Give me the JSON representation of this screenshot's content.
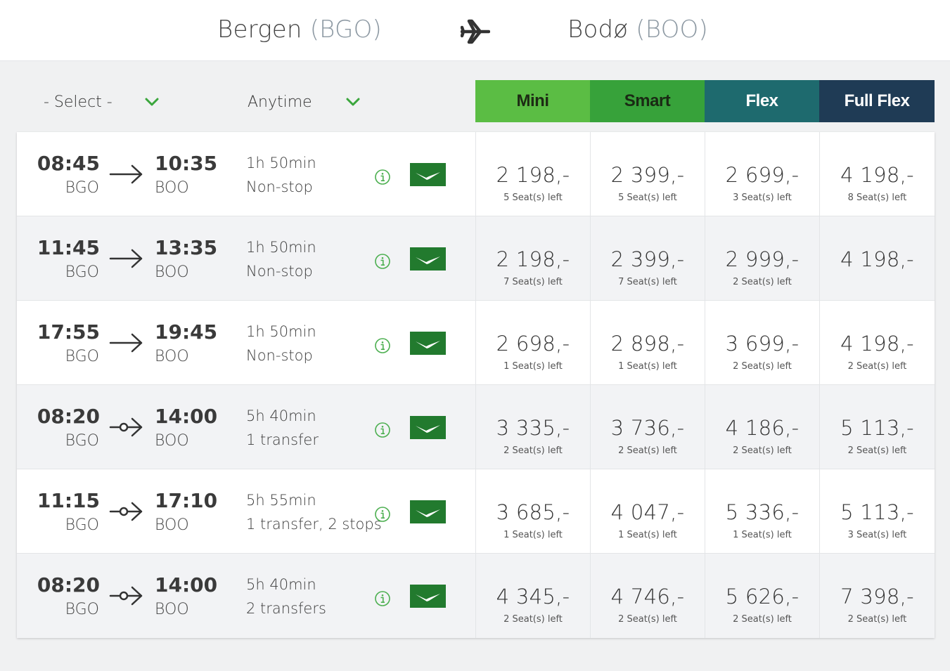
{
  "route": {
    "origin_city": "Bergen",
    "origin_code": "(BGO)",
    "dest_city": "Bodø",
    "dest_code": "(BOO)"
  },
  "filters": {
    "stops_label": "- Select -",
    "time_label": "Anytime"
  },
  "fare_classes": [
    "Mini",
    "Smart",
    "Flex",
    "Full Flex"
  ],
  "colors": {
    "mini": "#5bbd44",
    "smart": "#37a23a",
    "flex": "#1e6a6e",
    "full_flex": "#1f3b55",
    "airline_green": "#227a2e",
    "info_green": "#4caf50"
  },
  "flights": [
    {
      "dep_time": "08:45",
      "dep_airport": "BGO",
      "arr_time": "10:35",
      "arr_airport": "BOO",
      "duration": "1h 50min",
      "stops": "Non-stop",
      "direct": true,
      "fares": [
        {
          "price": "2 198,-",
          "seats": "5 Seat(s) left"
        },
        {
          "price": "2 399,-",
          "seats": "5 Seat(s) left"
        },
        {
          "price": "2 699,-",
          "seats": "3 Seat(s) left"
        },
        {
          "price": "4 198,-",
          "seats": "8 Seat(s) left"
        }
      ]
    },
    {
      "dep_time": "11:45",
      "dep_airport": "BGO",
      "arr_time": "13:35",
      "arr_airport": "BOO",
      "duration": "1h 50min",
      "stops": "Non-stop",
      "direct": true,
      "fares": [
        {
          "price": "2 198,-",
          "seats": "7 Seat(s) left"
        },
        {
          "price": "2 399,-",
          "seats": "7 Seat(s) left"
        },
        {
          "price": "2 999,-",
          "seats": "2 Seat(s) left"
        },
        {
          "price": "4 198,-",
          "seats": ""
        }
      ]
    },
    {
      "dep_time": "17:55",
      "dep_airport": "BGO",
      "arr_time": "19:45",
      "arr_airport": "BOO",
      "duration": "1h 50min",
      "stops": "Non-stop",
      "direct": true,
      "fares": [
        {
          "price": "2 698,-",
          "seats": "1 Seat(s) left"
        },
        {
          "price": "2 898,-",
          "seats": "1 Seat(s) left"
        },
        {
          "price": "3 699,-",
          "seats": "2 Seat(s) left"
        },
        {
          "price": "4 198,-",
          "seats": "2 Seat(s) left"
        }
      ]
    },
    {
      "dep_time": "08:20",
      "dep_airport": "BGO",
      "arr_time": "14:00",
      "arr_airport": "BOO",
      "duration": "5h 40min",
      "stops": "1 transfer",
      "direct": false,
      "fares": [
        {
          "price": "3 335,-",
          "seats": "2 Seat(s) left"
        },
        {
          "price": "3 736,-",
          "seats": "2 Seat(s) left"
        },
        {
          "price": "4 186,-",
          "seats": "2 Seat(s) left"
        },
        {
          "price": "5 113,-",
          "seats": "2 Seat(s) left"
        }
      ]
    },
    {
      "dep_time": "11:15",
      "dep_airport": "BGO",
      "arr_time": "17:10",
      "arr_airport": "BOO",
      "duration": "5h 55min",
      "stops": "1 transfer, 2 stops",
      "direct": false,
      "fares": [
        {
          "price": "3 685,-",
          "seats": "1 Seat(s) left"
        },
        {
          "price": "4 047,-",
          "seats": "1 Seat(s) left"
        },
        {
          "price": "5 336,-",
          "seats": "1 Seat(s) left"
        },
        {
          "price": "5 113,-",
          "seats": "3 Seat(s) left"
        }
      ]
    },
    {
      "dep_time": "08:20",
      "dep_airport": "BGO",
      "arr_time": "14:00",
      "arr_airport": "BOO",
      "duration": "5h 40min",
      "stops": "2 transfers",
      "direct": false,
      "fares": [
        {
          "price": "4 345,-",
          "seats": "2 Seat(s) left"
        },
        {
          "price": "4 746,-",
          "seats": "2 Seat(s) left"
        },
        {
          "price": "5 626,-",
          "seats": "2 Seat(s) left"
        },
        {
          "price": "7 398,-",
          "seats": "2 Seat(s) left"
        }
      ]
    }
  ]
}
